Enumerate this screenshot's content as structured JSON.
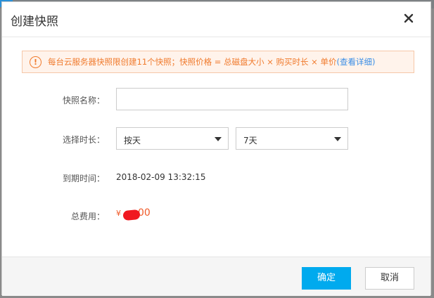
{
  "dialog": {
    "title": "创建快照",
    "close_label": "×"
  },
  "notice": {
    "icon_glyph": "!",
    "text": "每台云服务器快照限创建11个快照；快照价格 = 总磁盘大小 × 购买时长 × 单价",
    "link": "(查看详细)"
  },
  "form": {
    "name_label": "快照名称：",
    "name_value": "",
    "duration_label": "选择时长：",
    "unit_selected": "按天",
    "period_selected": "7天",
    "expiry_label": "到期时间：",
    "expiry_value": "2018-02-09 13:32:15",
    "cost_label": "总费用：",
    "currency": "¥",
    "cost_visible": "00"
  },
  "footer": {
    "confirm_label": "确定",
    "cancel_label": "取消"
  },
  "colors": {
    "accent": "#00aaee",
    "warning": "#f07a2c",
    "price": "#f05a28",
    "link": "#3a8ee6"
  }
}
